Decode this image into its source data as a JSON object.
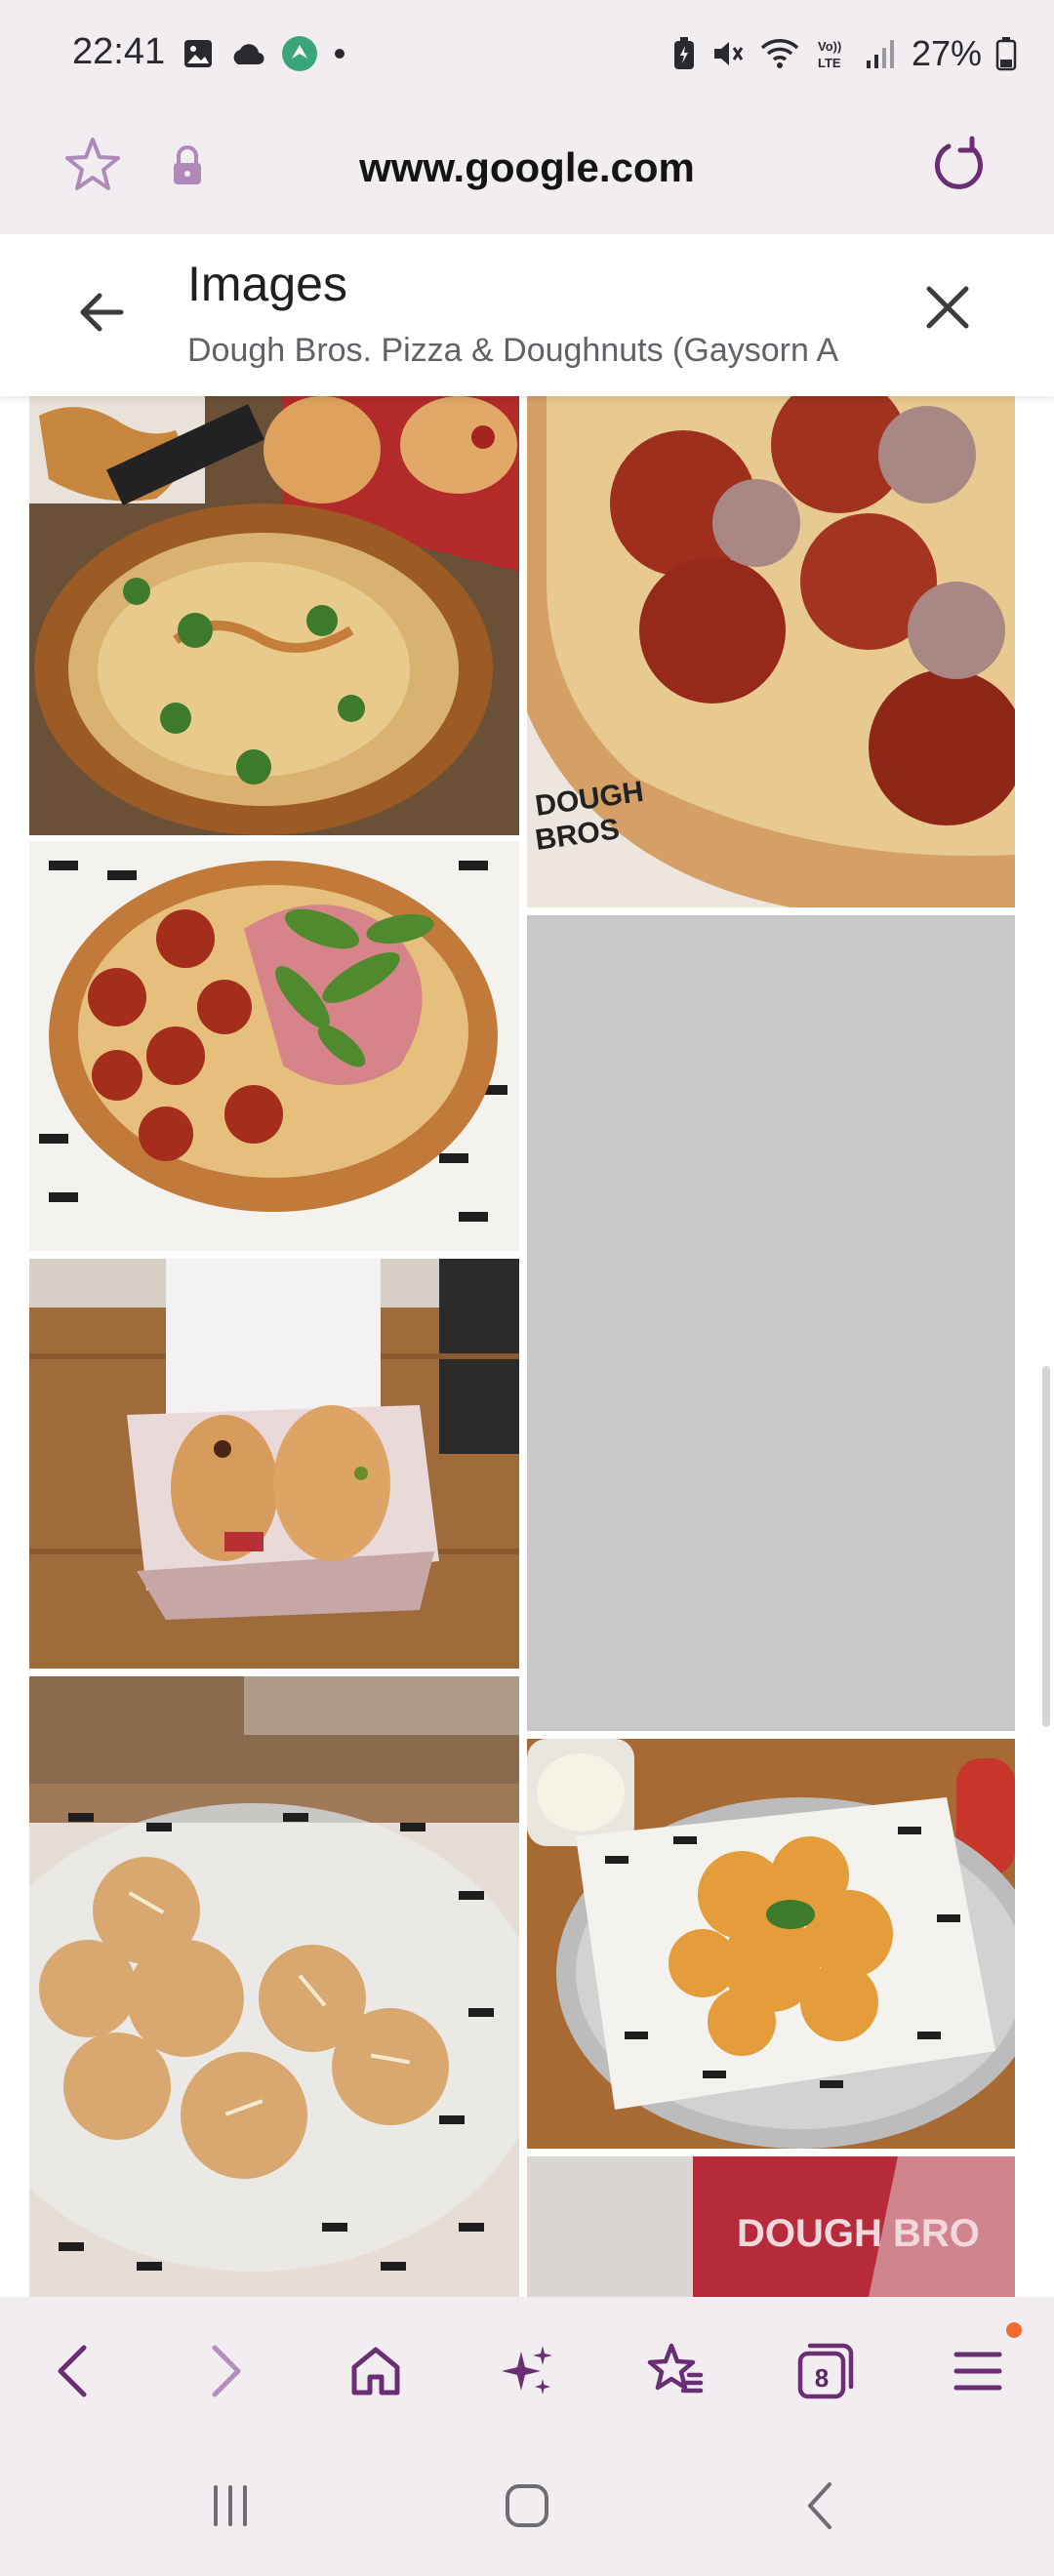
{
  "status_bar": {
    "time": "22:41",
    "battery": "27%",
    "icons_left": [
      "gallery-icon",
      "cloud-icon",
      "app-icon",
      "dot-icon"
    ],
    "icons_right": [
      "battery-saver-icon",
      "mute-icon",
      "wifi-icon",
      "volte-icon",
      "signal-icon",
      "battery-icon"
    ]
  },
  "url_bar": {
    "url": "www.google.com"
  },
  "images_panel": {
    "title": "Images",
    "subtitle": "Dough Bros. Pizza & Doughnuts (Gaysorn A"
  },
  "image_tiles": [
    {
      "name": "pizza-with-chicken-and-doughnuts"
    },
    {
      "name": "pepperoni-pizza-closeup"
    },
    {
      "name": "pepperoni-prosciutto-arugula-pizza"
    },
    {
      "name": "image-loading-placeholder"
    },
    {
      "name": "doughnuts-in-box"
    },
    {
      "name": "garlic-knots-plate"
    },
    {
      "name": "fried-chicken-plate"
    },
    {
      "name": "dough-bros-sign"
    }
  ],
  "sign_text": "DOUGH BRO",
  "toolbar": {
    "items": [
      "back",
      "forward",
      "home",
      "ai-assistant",
      "bookmarks",
      "tabs",
      "menu"
    ],
    "tab_count": "8"
  },
  "colors": {
    "accent": "#6b2d73",
    "chrome_bg": "#f1edf1",
    "notification": "#f26b2f",
    "placeholder": "#c8c8c8"
  }
}
